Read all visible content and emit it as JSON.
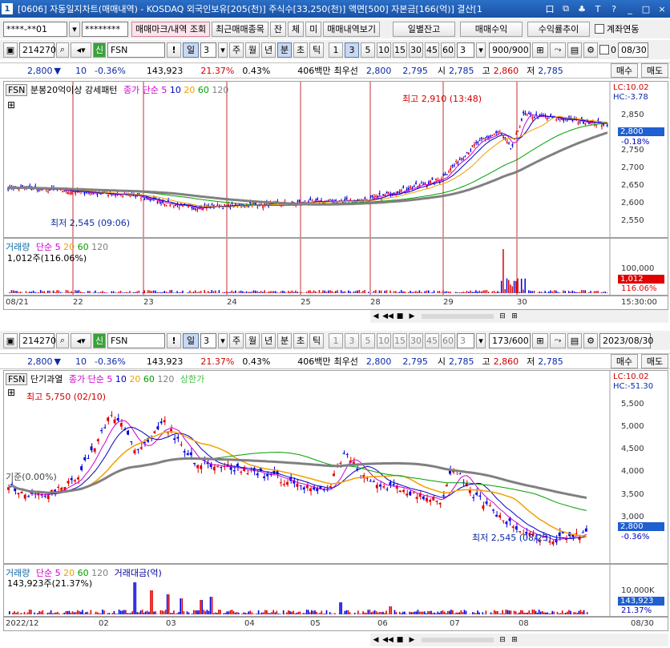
{
  "window": {
    "num": "1",
    "title": "[0606] 자동일지차트(매매내역) - KOSDAQ 외국인보유[205(천)] 주식수[33,250(천)] 액면[500] 자본금[166(억)] 결산[1",
    "ctrls": [
      "口",
      "⧉",
      "♣",
      "T",
      "?",
      "_",
      "□",
      "×"
    ]
  },
  "toolbar1": {
    "account": "****-**01",
    "password": "********",
    "b1": "매매마크/내역 조회",
    "b2": "최근매매종목",
    "b3": "잔",
    "b4": "체",
    "b5": "미",
    "b6": "매매내역보기",
    "b7": "일별잔고",
    "b8": "매매수익",
    "b9": "수익률추이",
    "chk": "계좌연동"
  },
  "top": {
    "toolbar": {
      "code": "214270",
      "badge": "신",
      "name": "FSN",
      "excl": "!",
      "period": "일",
      "count": "3",
      "tabs": [
        "주",
        "월",
        "년",
        "분",
        "초",
        "틱"
      ],
      "nums": [
        "1",
        "3",
        "5",
        "10",
        "15",
        "30",
        "45",
        "60"
      ],
      "sel": "3",
      "ratio": "900/900",
      "check": "0",
      "date": "08/30"
    },
    "quote": {
      "price": "2,800",
      "arrow": "▼",
      "change": "10",
      "pct": "-0.36%",
      "volume": "143,923",
      "turnover": "21.37%",
      "rate": "0.43%",
      "amt": "406백만",
      "bestlabel": "최우선",
      "bid": "2,800",
      "ask": "2,795",
      "openlbl": "시",
      "open": "2,785",
      "highlbl": "고",
      "high": "2,860",
      "lowlbl": "저",
      "low": "2,785",
      "buy": "매수",
      "sell": "매도"
    },
    "legend": {
      "fsn": "FSN",
      "pattern": "분봉20억이상 강세패턴",
      "ma_label": "종가 단순",
      "ma": [
        "5",
        "10",
        "20",
        "60",
        "120"
      ],
      "lc": "LC:10.02",
      "hc": "HC:-3.78"
    },
    "annotations": {
      "high": "최고 2,910 (13:48)",
      "low": "최저 2,545 (09:06)"
    },
    "yticks": [
      "2,850",
      "2,800",
      "2,750",
      "2,700",
      "2,650",
      "2,600",
      "2,550"
    ],
    "last": "2,800",
    "lastpct": "-0.18%",
    "vol": {
      "label": "거래량",
      "ma_label": "단순",
      "ma": [
        "5",
        "20",
        "60",
        "120"
      ],
      "value": "1,012주(116.06%)",
      "ytick": "100,000",
      "last": "1,012",
      "lastpct": "116.06%"
    },
    "xlabels": [
      "08/21",
      "22",
      "23",
      "24",
      "25",
      "28",
      "29",
      "30"
    ],
    "time": "15:30:00"
  },
  "bottom": {
    "toolbar": {
      "code": "214270",
      "badge": "신",
      "name": "FSN",
      "excl": "!",
      "period": "일",
      "count": "3",
      "tabs": [
        "주",
        "월",
        "년",
        "분",
        "초",
        "틱"
      ],
      "nums": [
        "1",
        "3",
        "5",
        "10",
        "15",
        "30",
        "45",
        "60"
      ],
      "sel": "3",
      "ratio": "173/600",
      "date": "2023/08/30"
    },
    "quote": {
      "price": "2,800",
      "arrow": "▼",
      "change": "10",
      "pct": "-0.36%",
      "volume": "143,923",
      "turnover": "21.37%",
      "rate": "0.43%",
      "amt": "406백만",
      "bestlabel": "최우선",
      "bid": "2,800",
      "ask": "2,795",
      "openlbl": "시",
      "open": "2,785",
      "highlbl": "고",
      "high": "2,860",
      "lowlbl": "저",
      "low": "2,785",
      "buy": "매수",
      "sell": "매도"
    },
    "legend": {
      "fsn": "FSN",
      "pattern": "단기과열",
      "ma_label": "종가 단순",
      "ma": [
        "5",
        "10",
        "20",
        "60",
        "120"
      ],
      "extra": "상한가",
      "lc": "LC:10.02",
      "hc": "HC:-51.30"
    },
    "annotations": {
      "high": "최고 5,750 (02/10)",
      "low": "최저 2,545 (08/23)",
      "base": "기준(0.00%)"
    },
    "yticks": [
      "5,500",
      "5,000",
      "4,500",
      "4,000",
      "3,500",
      "3,000",
      "2,500"
    ],
    "last": "2,800",
    "lastpct": "-0.36%",
    "vol": {
      "label": "거래량",
      "ma_label": "단순",
      "ma": [
        "5",
        "20",
        "60",
        "120"
      ],
      "extra": "거래대금(억)",
      "value": "143,923주(21.37%)",
      "ytick": "10,000K",
      "last": "143,923",
      "lastpct": "21.37%"
    },
    "xlabels": [
      "2022/12",
      "02",
      "03",
      "04",
      "05",
      "06",
      "07",
      "08"
    ],
    "time": "08/30"
  },
  "colors": {
    "up": "#e00000",
    "down": "#0000e0",
    "ma5": "#d000d0",
    "ma10": "#0000c0",
    "ma20": "#f0a000",
    "ma60": "#00a000",
    "ma120": "#808080"
  }
}
